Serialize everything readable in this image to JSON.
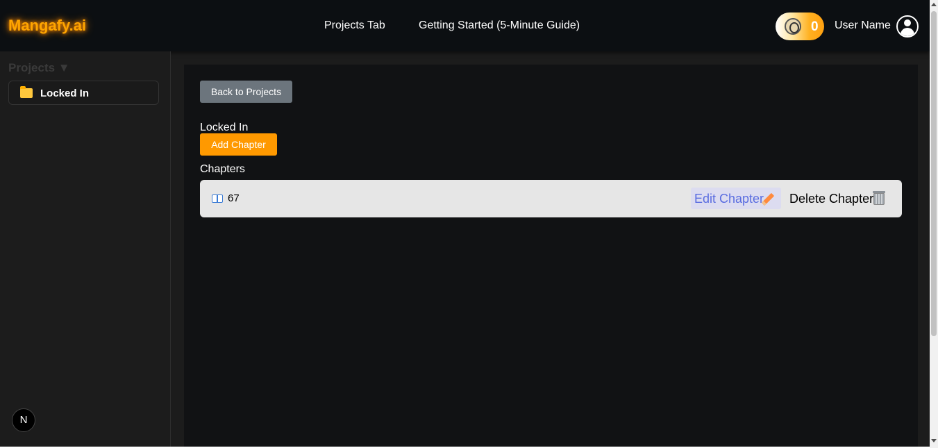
{
  "header": {
    "logo": "Mangafy.ai",
    "nav": {
      "projects_tab": "Projects Tab",
      "getting_started": "Getting Started (5-Minute Guide)"
    },
    "credits": {
      "count": "0",
      "icon": "coin-icon"
    },
    "user_name": "User Name"
  },
  "sidebar": {
    "title": "Projects ▼",
    "items": [
      {
        "label": "Locked In",
        "icon": "folder-icon"
      }
    ],
    "badge": "N"
  },
  "main": {
    "back_button": "Back to Projects",
    "project_title": "Locked In",
    "add_chapter_button": "Add Chapter",
    "chapters_label": "Chapters",
    "chapters": [
      {
        "name": "67",
        "edit_label": "Edit Chapter",
        "delete_label": "Delete Chapter"
      }
    ]
  },
  "colors": {
    "accent": "#ff9900",
    "logo": "#ffa500",
    "edit_text": "#5a6de0",
    "secondary_button": "#6c757d"
  }
}
